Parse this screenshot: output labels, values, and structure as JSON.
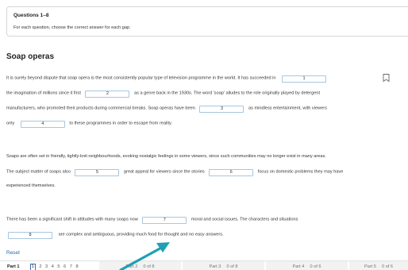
{
  "instructions": {
    "title": "Questions 1–8",
    "text": "For each question, choose the correct answer for each gap."
  },
  "heading": "Soap operas",
  "passage": {
    "l1a": "It is surely beyond dispute that soap opera is the most consistently popular type of television programme in the world. It has succeeded in",
    "g1": "1",
    "l2a": "the imagination of millions since it first",
    "g2": "2",
    "l2b": "as a genre back in the 1930s. The word 'soap' alludes to the role originally played by detergent",
    "l3a": "manufacturers, who promoted their products during commercial breaks. Soap operas have been",
    "g3": "3",
    "l3b": "as mindless entertainment, with viewers",
    "l4a": "only",
    "g4": "4",
    "l4b": "to these programmes in order to escape from reality.",
    "l5a": "Soaps are often set in friendly, tightly-knit neighbourhoods, evoking nostalgic feelings in some viewers, since such communities may no longer exist in many areas.",
    "l6a": "The subject matter of soaps also",
    "g5": "5",
    "l6b": "great appeal for viewers since the stories",
    "g6": "6",
    "l6c": "focus on domestic problems they may have",
    "l7a": "experienced themselves.",
    "l8a": "There has been a significant shift in attitudes with many soaps now",
    "g7": "7",
    "l8b": "moral and social issues. The characters and situations",
    "g8": "8",
    "l9b": "are complex and ambiguous, providing much food for thought and no easy answers."
  },
  "reset_label": "Reset",
  "footer": {
    "part1_label": "Part 1",
    "part1_questions": [
      "1",
      "2",
      "3",
      "4",
      "5",
      "6",
      "7",
      "8"
    ],
    "part2_label": "Part 2",
    "part2_status": "0 of 8",
    "part3_label": "Part 3",
    "part3_status": "0 of 8",
    "part4_label": "Part 4",
    "part4_status": "0 of 6",
    "part5_label": "Part 5",
    "part5_status": "0 of 6"
  },
  "colors": {
    "accent": "#3a6cb4",
    "gap_border": "#a8c7df",
    "arrow": "#1fa0b2",
    "link": "#2a6ab1"
  },
  "icons": {
    "bookmark": "bookmark-icon",
    "pointer": "arrow-pointer-icon"
  }
}
